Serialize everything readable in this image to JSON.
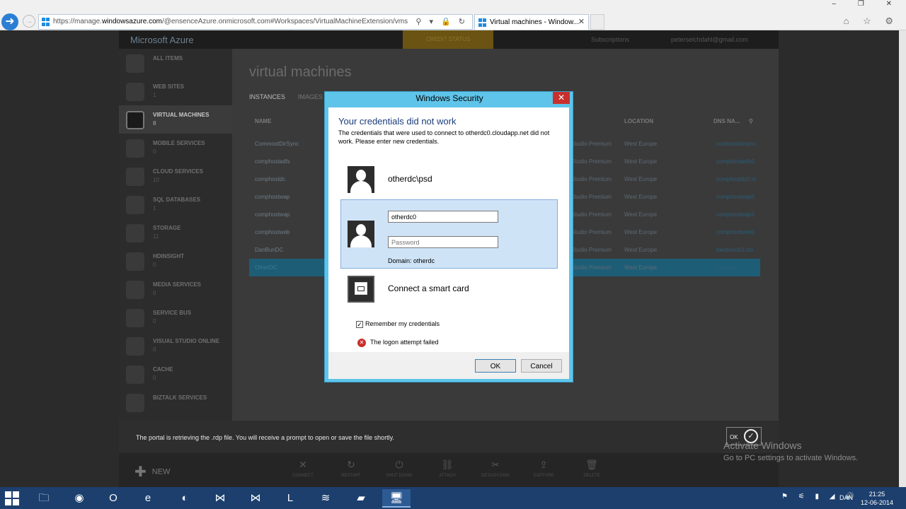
{
  "browser": {
    "url_prefix": "https://manage.",
    "url_domain": "windowsazure.com",
    "url_rest": "/@ensenceAzure.onmicrosoft.com#Workspaces/VirtualMachineExtension/vms",
    "tab_title": "Virtual machines - Window...",
    "tab_close": "✕",
    "addr_icons": "⚲ ▾ 🔒 ↻",
    "window_controls": "‒ ❐ ✕",
    "toolbar_icons": "⌂ ☆ ⚙",
    "back_icon": "➜",
    "forward_icon": "→"
  },
  "portal": {
    "brand": "Microsoft Azure",
    "credit_status": "CREDIT STATUS",
    "subscriptions": "Subscriptions",
    "user": "peterselchdahl@gmail.com",
    "nav": [
      {
        "label": "ALL ITEMS",
        "count": ""
      },
      {
        "label": "WEB SITES",
        "count": "1"
      },
      {
        "label": "VIRTUAL MACHINES",
        "count": "8"
      },
      {
        "label": "MOBILE SERVICES",
        "count": "0"
      },
      {
        "label": "CLOUD SERVICES",
        "count": "10"
      },
      {
        "label": "SQL DATABASES",
        "count": "1"
      },
      {
        "label": "STORAGE",
        "count": "11"
      },
      {
        "label": "HDINSIGHT",
        "count": "0"
      },
      {
        "label": "MEDIA SERVICES",
        "count": "0"
      },
      {
        "label": "SERVICE BUS",
        "count": "0"
      },
      {
        "label": "VISUAL STUDIO ONLINE",
        "count": "0"
      },
      {
        "label": "CACHE",
        "count": "0"
      },
      {
        "label": "BIZTALK SERVICES",
        "count": ""
      }
    ],
    "title": "virtual machines",
    "tabs": [
      "INSTANCES",
      "IMAGES"
    ],
    "columns": {
      "name": "NAME",
      "location": "LOCATION",
      "dns": "DNS NA..."
    },
    "rows": [
      {
        "name": "CommostDirSync",
        "sub": "Studio Premium",
        "loc": "West Europe",
        "dns": "comhostdirsync"
      },
      {
        "name": "comphostadfs",
        "sub": "Studio Premium",
        "loc": "West Europe",
        "dns": "comphostadfs0"
      },
      {
        "name": "comphostdc",
        "sub": "Studio Premium",
        "loc": "West Europe",
        "dns": "comphostdc0.cl"
      },
      {
        "name": "comphostwap",
        "sub": "Studio Premium",
        "loc": "West Europe",
        "dns": "comphostwap0"
      },
      {
        "name": "comphostwap",
        "sub": "Studio Premium",
        "loc": "West Europe",
        "dns": "comphostwap2"
      },
      {
        "name": "comphostweb",
        "sub": "Studio Premium",
        "loc": "West Europe",
        "dns": "comphostweb0"
      },
      {
        "name": "DanBunDC",
        "sub": "Studio Premium",
        "loc": "West Europe",
        "dns": "danbundc0.clo"
      },
      {
        "name": "OtherDC",
        "sub": "Studio Premium",
        "loc": "West Europe",
        "dns": "otherdc0"
      }
    ],
    "notification": "The portal is retrieving the .rdp file. You will receive a prompt to open or save the file shortly.",
    "ok_label": "OK",
    "ok_check": "✓",
    "new_label": "NEW",
    "new_plus": "✚",
    "commands": [
      {
        "glyph": "✕",
        "label": "CONNECT"
      },
      {
        "glyph": "↻",
        "label": "RESTART"
      },
      {
        "glyph": "⏻",
        "label": "SHUT DOWN"
      },
      {
        "glyph": "⛓",
        "label": "ATTACH"
      },
      {
        "glyph": "✂",
        "label": "DETACH DISK"
      },
      {
        "glyph": "⇪",
        "label": "CAPTURE"
      },
      {
        "glyph": "🗑",
        "label": "DELETE"
      }
    ]
  },
  "watermark": {
    "line1": "Activate Windows",
    "line2": "Go to PC settings to activate Windows."
  },
  "dialog": {
    "title": "Windows Security",
    "close": "✕",
    "heading": "Your credentials did not work",
    "description": "The credentials that were used to connect to otherdc0.cloudapp.net did not work. Please enter new credentials.",
    "user1": "otherdc\\psd",
    "username_value": "otherdc0",
    "password_placeholder": "Password",
    "domain": "Domain: otherdc",
    "smart_card": "Connect a smart card",
    "remember": "Remember my credentials",
    "remember_check": "✓",
    "error_icon": "✕",
    "error": "The logon attempt failed",
    "ok": "OK",
    "cancel": "Cancel"
  },
  "taskbar": {
    "apps": [
      {
        "name": "file-explorer",
        "glyph": "🗀"
      },
      {
        "name": "chrome",
        "glyph": "◉"
      },
      {
        "name": "outlook",
        "glyph": "O"
      },
      {
        "name": "internet-explorer",
        "glyph": "e"
      },
      {
        "name": "skype",
        "glyph": "◐"
      },
      {
        "name": "visual-studio",
        "glyph": "⋈"
      },
      {
        "name": "visual-studio-2",
        "glyph": "⋈"
      },
      {
        "name": "lync",
        "glyph": "L"
      },
      {
        "name": "spotify",
        "glyph": "≋"
      },
      {
        "name": "app",
        "glyph": "▰"
      },
      {
        "name": "remote-desktop",
        "glyph": "🖥"
      }
    ],
    "tray_icons": "⚑ ⚟ ▮ ◢ 🔊",
    "lang": "DAN",
    "time": "21:25",
    "date": "12-06-2014"
  }
}
